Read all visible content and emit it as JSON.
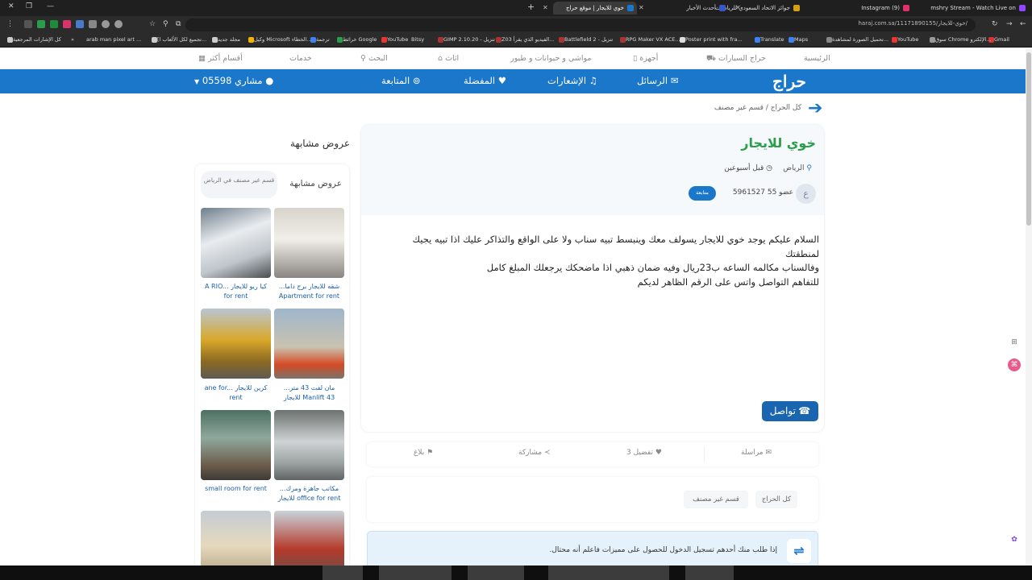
{
  "browser": {
    "tabs": [
      {
        "title": "mshry Stream - Watch Live on",
        "color": "#9146ff",
        "active": false
      },
      {
        "title": "Instagram (9)",
        "color": "#e1306c",
        "active": false
      },
      {
        "title": "جوائز الاتحاد السعودي للرياضات",
        "color": "#d4a017",
        "active": false
      },
      {
        "title": "أحدث الأخبار",
        "color": "#3a56c5",
        "active": false
      },
      {
        "title": "خوي للايجار | موقع حراج",
        "color": "#1a77c9",
        "active": true
      }
    ],
    "url": "haraj.com.sa/11171890155/خوي-للايجار/",
    "bookmarks": [
      "Gmail",
      "YouTube",
      "سوق Chrome الإلكترو...",
      "تحميل الصورة لمشاهدة...",
      "YouTube",
      "Maps",
      "Translate",
      "Poster print with fra...",
      "RPG Maker VX ACE...",
      "Battlefield 2 - تنزيل",
      "Z03 الفيديو الذي يقرأ...",
      "GIMP 2.10.20 - تنزيل",
      "Bitsy",
      "YouTube",
      "خرائط Google",
      "ترجمة",
      "وكيل Microsoft الخطاء...",
      "مجلد جديد",
      "[تجميع لكل الألعاب ا...",
      "arab man pixel art ...",
      "كل الإشارات المرجعية"
    ]
  },
  "topnav": {
    "items": [
      "الرئيسية",
      "حراج السيارات",
      "أجهزة",
      "مواشي و حيوانات و طيور",
      "اثاث",
      "البحث",
      "خدمات",
      "أقسام أكثر"
    ]
  },
  "mainbar": {
    "logo": "حراج",
    "messages": "الرسائل",
    "notifications": "الإشعارات",
    "favorites": "المفضلة",
    "following": "المتابعة",
    "account": "مشاري 05598"
  },
  "breadcrumb": {
    "root": "كل الحراج",
    "separator": "/",
    "section": "قسم غير مصنف"
  },
  "post": {
    "title": "خوي للايجار",
    "location": "الرياض",
    "time": "قبل أسبوعين",
    "avatar_letter": "ع",
    "member": "عضو 55 5961527",
    "follow": "متابعة",
    "body_lines": [
      "السلام عليكم يوجد خوي للايجار يسولف معك وينبسط تبيه سناب ولا على الواقع والتذاكر عليك اذا تبيه يجيك لمنطقتك",
      "وفالسناب مكالمه الساعه ب23ريال وفيه ضمان ذهبي اذا ماضحكك يرجعلك المبلغ كامل",
      "للتفاهم التواصل واتس على الرقم الظاهر لديكم"
    ],
    "contact": "تواصل"
  },
  "actions": {
    "message": "مراسلة",
    "favorite": "3 تفضيل",
    "share": "مشاركة",
    "report": "بلاغ"
  },
  "tags": [
    "كل الحراج",
    "قسم غير مصنف"
  ],
  "notice": "إذا طلب منك أحدهم تسجيل الدخول للحصول على مميزات فاعلم أنه محتال.",
  "similar": {
    "title": "عروض مشابهة",
    "header": "عروض مشابهة",
    "pill": "قسم غير مصنف في الرياض",
    "items": [
      {
        "caption": "شقه للايجار برج داما... Apartment for rent"
      },
      {
        "caption": "كيا ريو للايجار A RIO... for rent"
      },
      {
        "caption": "مان لفت 43 متر... Manlift 43 للايجار"
      },
      {
        "caption": "كرين للايجار ane for... rent"
      },
      {
        "caption": "مكاتب جاهزة ومرك... office for rent للايجار"
      },
      {
        "caption": "small room for rent"
      }
    ]
  }
}
